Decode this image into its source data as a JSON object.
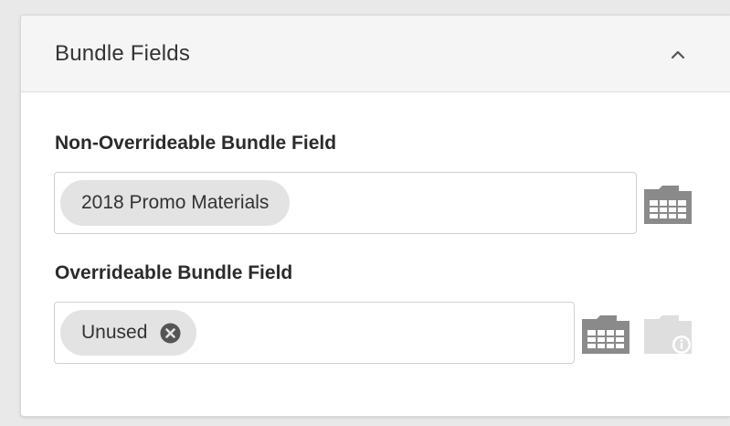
{
  "panel": {
    "title": "Bundle Fields",
    "collapse_icon": "chevron-up-icon"
  },
  "non_overrideable": {
    "label": "Non-Overrideable Bundle Field",
    "chip_text": "2018 Promo Materials",
    "picker_icon": "folder-grid-icon"
  },
  "overrideable": {
    "label": "Overrideable Bundle Field",
    "chip_text": "Unused",
    "remove_icon": "remove-circle-icon",
    "picker_icon": "folder-grid-icon",
    "info_icon": "folder-info-icon"
  },
  "colors": {
    "icon_active": "#8a8a8a",
    "icon_disabled": "#dedede",
    "chip_bg": "#e3e3e3",
    "header_bg": "#f5f5f5"
  }
}
